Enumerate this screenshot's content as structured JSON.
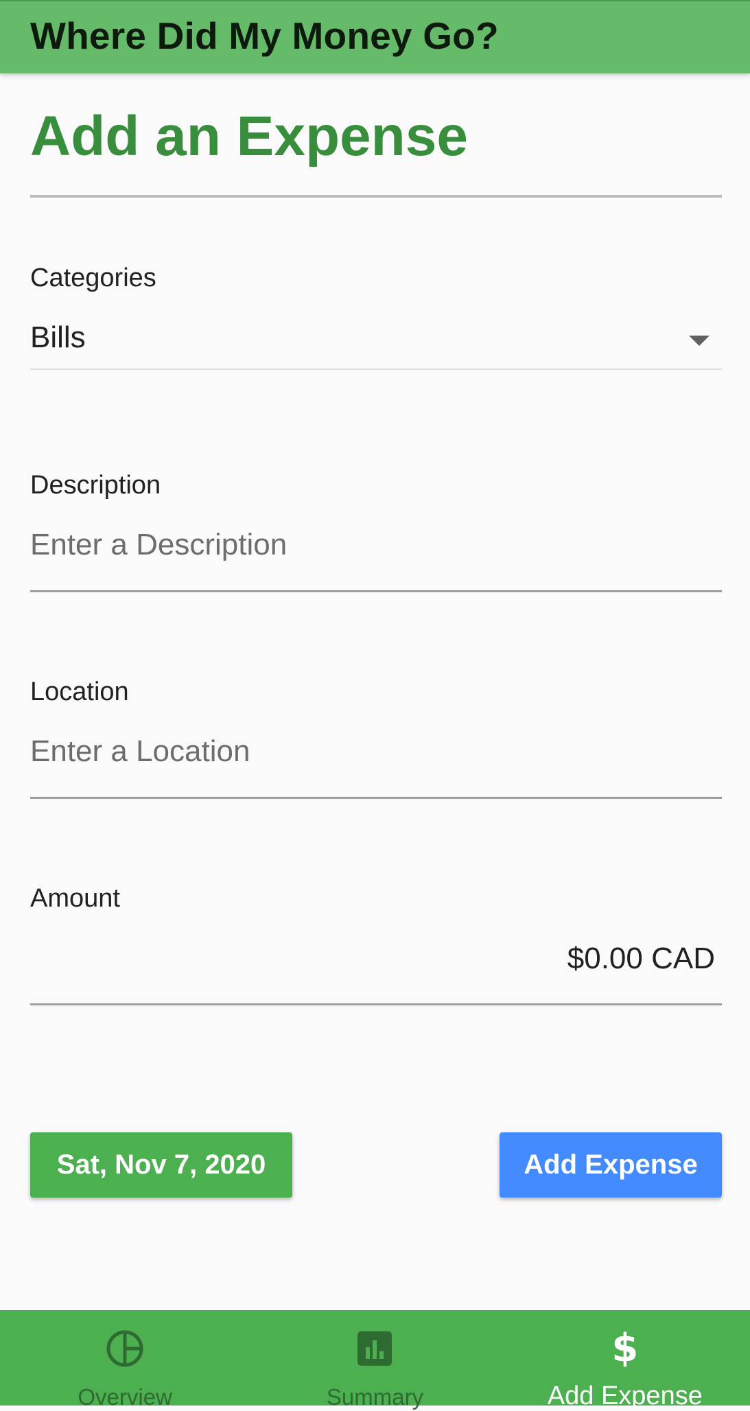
{
  "app_bar": {
    "title": "Where Did My Money Go?"
  },
  "page": {
    "title": "Add an Expense"
  },
  "form": {
    "category": {
      "label": "Categories",
      "selected": "Bills"
    },
    "description": {
      "label": "Description",
      "placeholder": "Enter a Description"
    },
    "location": {
      "label": "Location",
      "placeholder": "Enter a Location"
    },
    "amount": {
      "label": "Amount",
      "value": "$0.00 CAD"
    }
  },
  "buttons": {
    "date_label": "Sat, Nov 7, 2020",
    "add_label": "Add Expense"
  },
  "bottom_nav": {
    "items": [
      {
        "label": "Overview",
        "icon": "pie-chart-icon",
        "active": false
      },
      {
        "label": "Summary",
        "icon": "bar-chart-icon",
        "active": false
      },
      {
        "label": "Add Expense",
        "icon": "dollar-icon",
        "active": true
      }
    ]
  },
  "colors": {
    "app_bar": "#66bb6a",
    "title_green": "#388e3c",
    "date_button": "#4caf50",
    "add_button": "#448aff",
    "bottom_nav": "#4caf50"
  }
}
